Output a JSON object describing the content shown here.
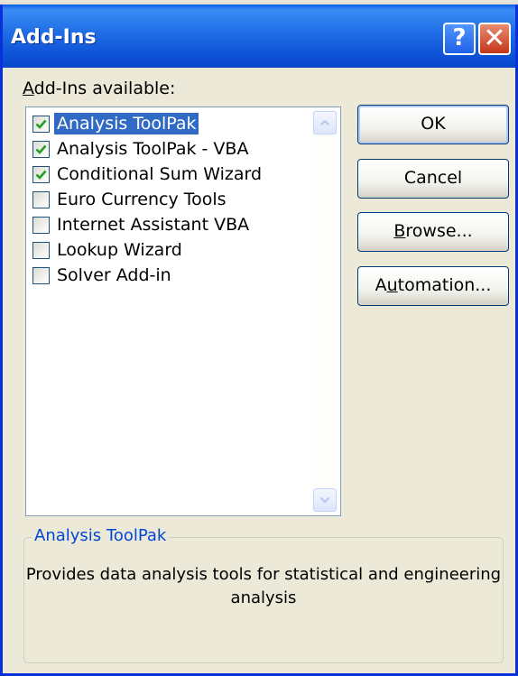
{
  "window": {
    "title": "Add-Ins",
    "help_glyph": "?",
    "close_glyph": "✕"
  },
  "list": {
    "label_prefix": "A",
    "label_rest": "dd-Ins available:",
    "items": [
      {
        "label": "Analysis ToolPak",
        "checked": true,
        "selected": true
      },
      {
        "label": "Analysis ToolPak - VBA",
        "checked": true,
        "selected": false
      },
      {
        "label": "Conditional Sum Wizard",
        "checked": true,
        "selected": false
      },
      {
        "label": "Euro Currency Tools",
        "checked": false,
        "selected": false
      },
      {
        "label": "Internet Assistant VBA",
        "checked": false,
        "selected": false
      },
      {
        "label": "Lookup Wizard",
        "checked": false,
        "selected": false
      },
      {
        "label": "Solver Add-in",
        "checked": false,
        "selected": false
      }
    ]
  },
  "buttons": {
    "ok": "OK",
    "cancel": "Cancel",
    "browse_accel": "B",
    "browse_rest": "rowse...",
    "automation_pre": "A",
    "automation_accel": "u",
    "automation_rest": "tomation..."
  },
  "details": {
    "title": "Analysis ToolPak",
    "description": "Provides data analysis tools for statistical and engineering analysis"
  },
  "colors": {
    "title_bar": "#0c4fd6",
    "selection": "#316ac5",
    "check": "#21a121",
    "group_title": "#0046d5"
  },
  "icons": {
    "help": "help-icon",
    "close": "close-icon",
    "scroll_up": "chevron-up-icon",
    "scroll_down": "chevron-down-icon",
    "check": "checkmark-icon"
  }
}
